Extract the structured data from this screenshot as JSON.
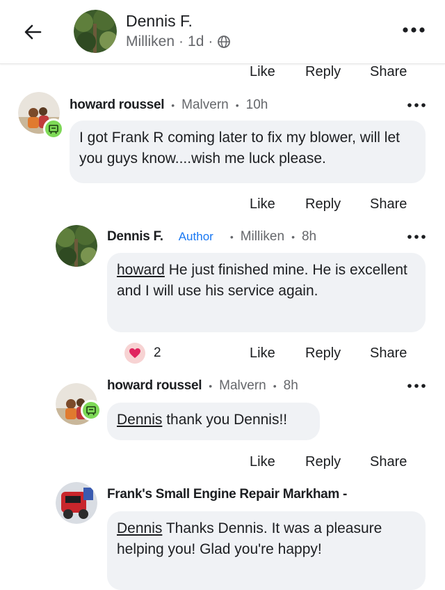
{
  "header": {
    "name": "Dennis F.",
    "location": "Milliken",
    "separator": "·",
    "time": "1d",
    "globe_icon": "globe-icon",
    "more_icon": "more-horizontal-icon"
  },
  "actions": {
    "like": "Like",
    "reply": "Reply",
    "share": "Share"
  },
  "comments": [
    {
      "name": "howard roussel",
      "author_badge": "",
      "location": "Malvern",
      "time": "10h",
      "mention": "",
      "text": "I got Frank R coming later to fix my blower, will let you guys know....wish me luck please."
    },
    {
      "name": "Dennis F.",
      "author_badge": "Author",
      "location": "Milliken",
      "time": "8h",
      "mention": "howard",
      "text": " He just finished mine. He is excellent and I will use his service again.",
      "reaction_count": "2"
    },
    {
      "name": "howard roussel",
      "location": "Malvern",
      "time": "8h",
      "mention": "Dennis",
      "text": " thank you Dennis!!"
    },
    {
      "name": "Frank's Small Engine Repair Markham -",
      "mention": "Dennis",
      "text": " Thanks Dennis. It was a pleasure helping you! Glad you're happy!"
    }
  ],
  "bullet": "•",
  "colors": {
    "link": "#1877f2",
    "bubble": "#f0f2f5",
    "badge": "#7ed957",
    "heart": "#e0245e"
  }
}
